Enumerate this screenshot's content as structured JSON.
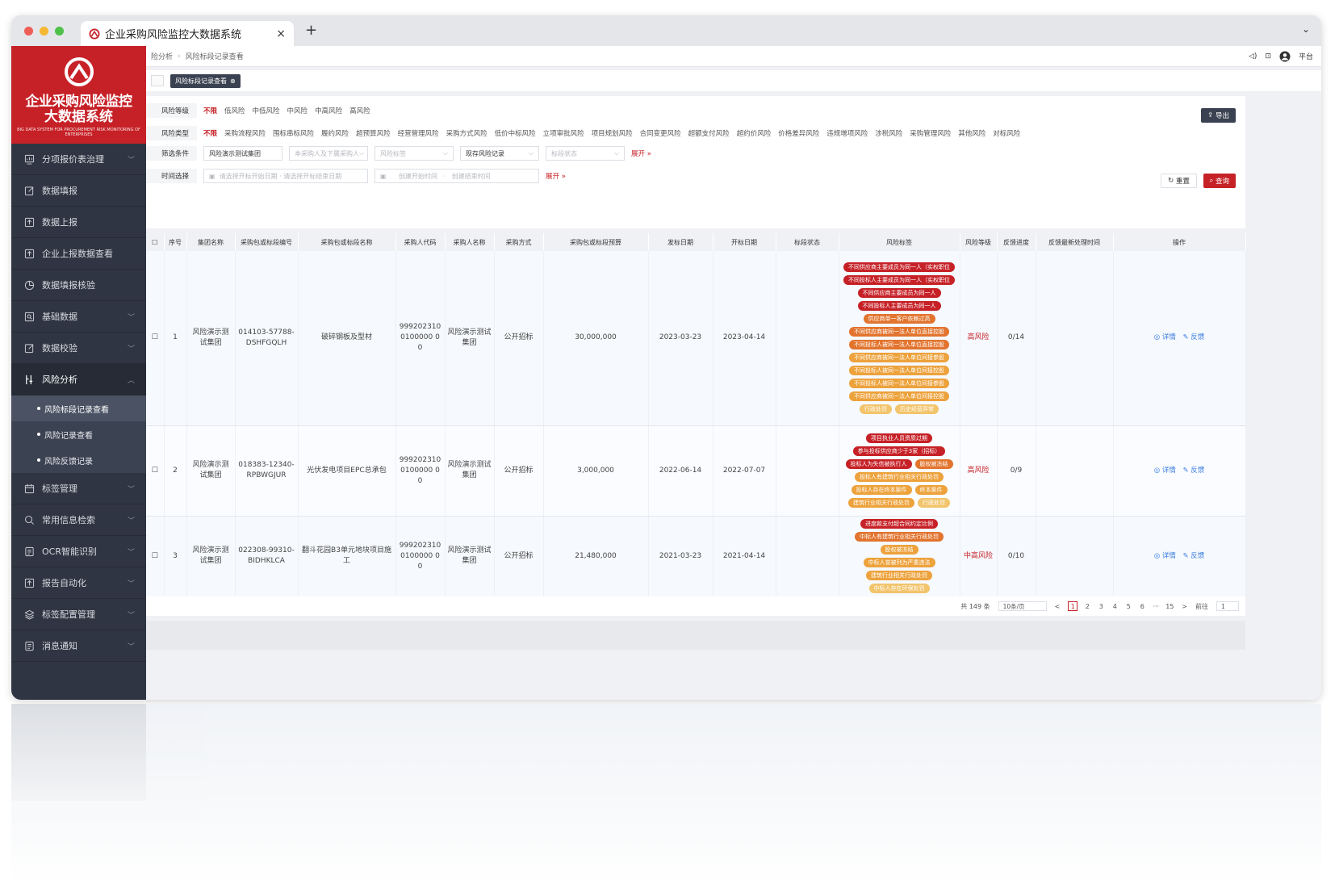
{
  "browser": {
    "tab_title": "企业采购风险监控大数据系统",
    "close": "×",
    "new_tab": "+",
    "chevron": "⌄"
  },
  "brand": {
    "line1": "企业采购风险监控",
    "line2": "大数据系统",
    "line3": "BIG DATA SYSTEM FOR PROCUREMENT RISK MONITORING OF ENTERPRISES"
  },
  "sidebar": {
    "items": [
      {
        "label": "分项报价表治理",
        "icon": "chart-icon",
        "chev": true
      },
      {
        "label": "数据填报",
        "icon": "edit-icon",
        "chev": false
      },
      {
        "label": "数据上报",
        "icon": "upload-icon",
        "chev": false
      },
      {
        "label": "企业上报数据查看",
        "icon": "upload-icon",
        "chev": false
      },
      {
        "label": "数据填报核验",
        "icon": "pie-icon",
        "chev": false
      },
      {
        "label": "基础数据",
        "icon": "search-doc-icon",
        "chev": true
      },
      {
        "label": "数据校验",
        "icon": "edit-icon",
        "chev": true
      }
    ],
    "open_item": {
      "label": "风险分析",
      "icon": "tools-icon"
    },
    "sub_items": [
      "风险标段记录查看",
      "风险记录查看",
      "风险反馈记录"
    ],
    "rest_items": [
      {
        "label": "标签管理",
        "icon": "calendar-icon"
      },
      {
        "label": "常用信息检索",
        "icon": "search-icon"
      },
      {
        "label": "OCR智能识别",
        "icon": "doc-icon"
      },
      {
        "label": "报告自动化",
        "icon": "upload-icon"
      },
      {
        "label": "标签配置管理",
        "icon": "layers-icon"
      },
      {
        "label": "消息通知",
        "icon": "doc-icon"
      }
    ]
  },
  "breadcrumb": {
    "parent": "险分析",
    "current": "风险标段记录查看"
  },
  "header_right": {
    "user": "平台"
  },
  "tags_bar": {
    "active_tag": "风险标段记录查看"
  },
  "filters": {
    "risk_level": {
      "label": "风险等级",
      "options": [
        "不限",
        "低风险",
        "中低风险",
        "中风险",
        "中高风险",
        "高风险"
      ],
      "selected": 0
    },
    "risk_type": {
      "label": "风险类型",
      "options": [
        "不限",
        "采购流程风险",
        "围标串标风险",
        "履约风险",
        "超预算风险",
        "经营管理风险",
        "采购方式风险",
        "低价中标风险",
        "立项审批风险",
        "项目规划风险",
        "合同变更风险",
        "超额支付风险",
        "超约价风险",
        "价格差异风险",
        "违规增项风险",
        "涉税风险",
        "采购管理风险",
        "其他风险",
        "对标风险"
      ],
      "selected": 0
    },
    "screen": {
      "label": "筛选条件",
      "group_value": "风险演示测试集团",
      "unit_placeholder": "本采购人及下属采购人",
      "tag_placeholder": "风险标签",
      "record_value": "现存风险记录",
      "status_placeholder": "标段状态",
      "expand": "展开 »"
    },
    "time": {
      "label": "时间选择",
      "start_ph": "请选择开标开始日期",
      "end_ph": "请选择开标结束日期",
      "c_start_ph": "创建开始时间",
      "c_end_ph": "创建结束时间",
      "expand": "展开 »"
    },
    "export": "导出",
    "reset": "重置",
    "query": "查询"
  },
  "table": {
    "headers": [
      "序号",
      "集团名称",
      "采购包或标段编号",
      "采购包或标段名称",
      "采购人代码",
      "采购人名称",
      "采购方式",
      "采购包或标段预算",
      "发标日期",
      "开标日期",
      "标段状态",
      "风险标签",
      "风险等级",
      "反馈进度",
      "反馈最新处理时间",
      "操作"
    ],
    "rows": [
      {
        "no": "1",
        "group": "风险演示测试集团",
        "code": "014103-57788-DSHFGQLH",
        "name": "破碎钢板及型材",
        "buyer_code": "9992023100100000 00",
        "buyer": "风险演示测试集团",
        "method": "公开招标",
        "budget": "30,000,000",
        "issue": "2023-03-23",
        "open": "2023-04-14",
        "status": "",
        "tags": [
          {
            "t": "不同供应商主要成员为同一人（实权职位",
            "c": "#c62127"
          },
          {
            "t": "不同投标人主要成员为同一人（实权职位",
            "c": "#c62127"
          },
          {
            "t": "不同供应商主要成员为同一人",
            "c": "#c62127"
          },
          {
            "t": "不同投标人主要成员为同一人",
            "c": "#c62127"
          },
          {
            "t": "供应商单一客户依赖过高",
            "c": "#e2742e"
          },
          {
            "t": "不同供应商被同一法人单位直接控股",
            "c": "#e2742e"
          },
          {
            "t": "不同投标人被同一法人单位直接控股",
            "c": "#e2742e"
          },
          {
            "t": "不同供应商被同一法人单位间接参股",
            "c": "#eda23c"
          },
          {
            "t": "不同投标人被同一法人单位间接控股",
            "c": "#eda23c"
          },
          {
            "t": "不同投标人被同一法人单位间接参股",
            "c": "#eda23c"
          },
          {
            "t": "不同供应商被同一法人单位间接控股",
            "c": "#eda23c"
          }
        ],
        "tag_pair": [
          {
            "t": "行政处罚",
            "c": "#f2c46b"
          },
          {
            "t": "历史经营异常",
            "c": "#f2c46b"
          }
        ],
        "level": "高风险",
        "progress": "0/14",
        "time": "",
        "detail": "◎ 详情",
        "feedback": "✎ 反馈"
      },
      {
        "no": "2",
        "group": "风险演示测试集团",
        "code": "018383-12340-RPBWGJUR",
        "name": "光伏发电项目EPC总承包",
        "buyer_code": "9992023100100000 00",
        "buyer": "风险演示测试集团",
        "method": "公开招标",
        "budget": "3,000,000",
        "issue": "2022-06-14",
        "open": "2022-07-07",
        "status": "",
        "tags": [
          {
            "t": "项目执业人员资质过期",
            "c": "#c62127"
          },
          {
            "t": "参与投标供应商少于3家（招标）",
            "c": "#c62127"
          }
        ],
        "tag_pair": [
          {
            "t": "投标人为失信被执行人",
            "c": "#c62127"
          },
          {
            "t": "股权被冻结",
            "c": "#e2742e"
          }
        ],
        "tags2": [
          {
            "t": "投标人有建筑行业相关行政处罚",
            "c": "#eda23c"
          }
        ],
        "tag_pair2": [
          {
            "t": "投标人存在终本案件",
            "c": "#eda23c"
          },
          {
            "t": "终本案件",
            "c": "#eda23c"
          }
        ],
        "tag_pair3": [
          {
            "t": "建筑行业相关行政处罚",
            "c": "#eda23c"
          },
          {
            "t": "行政处罚",
            "c": "#f2c46b"
          }
        ],
        "level": "高风险",
        "progress": "0/9",
        "time": "",
        "detail": "◎ 详情",
        "feedback": "✎ 反馈"
      },
      {
        "no": "3",
        "group": "风险演示测试集团",
        "code": "022308-99310-BIDHKLCA",
        "name": "翻斗花园B3单元地块项目施工",
        "buyer_code": "9992023100100000 00",
        "buyer": "风险演示测试集团",
        "method": "公开招标",
        "budget": "21,480,000",
        "issue": "2021-03-23",
        "open": "2021-04-14",
        "status": "",
        "tags": [
          {
            "t": "进度款支付超合同约定比例",
            "c": "#c62127"
          },
          {
            "t": "中标人有建筑行业相关行政处罚",
            "c": "#e2742e"
          },
          {
            "t": "股权被冻结",
            "c": "#eda23c"
          },
          {
            "t": "中标人曾被列为严重违法",
            "c": "#eda23c"
          },
          {
            "t": "建筑行业相关行政处罚",
            "c": "#eda23c"
          },
          {
            "t": "中标人存在环保处罚",
            "c": "#f2c46b"
          }
        ],
        "level": "中高风险",
        "progress": "0/10",
        "time": "",
        "detail": "◎ 详情",
        "feedback": "✎ 反馈"
      }
    ]
  },
  "pager": {
    "total": "共 149 条",
    "size": "10条/页",
    "pages": [
      "1",
      "2",
      "3",
      "4",
      "5",
      "6",
      "···",
      "15"
    ],
    "goto_label": "前往",
    "goto_value": "1",
    "prev": "<",
    "next": ">"
  }
}
